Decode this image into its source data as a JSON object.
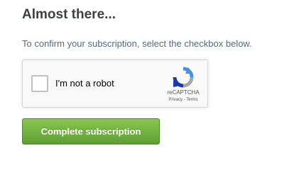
{
  "heading": "Almost there...",
  "instructions": "To confirm your subscription, select the checkbox below.",
  "recaptcha": {
    "checkbox_label": "I'm not a robot",
    "checked": false,
    "brand": "reCAPTCHA",
    "privacy_link": "Privacy",
    "separator": " - ",
    "terms_link": "Terms",
    "icon": "recaptcha-logo-icon"
  },
  "submit_button": {
    "label": "Complete subscription",
    "color": "#6aab3d"
  },
  "colors": {
    "heading": "#3d4043",
    "instructions": "#4f6b7c"
  }
}
